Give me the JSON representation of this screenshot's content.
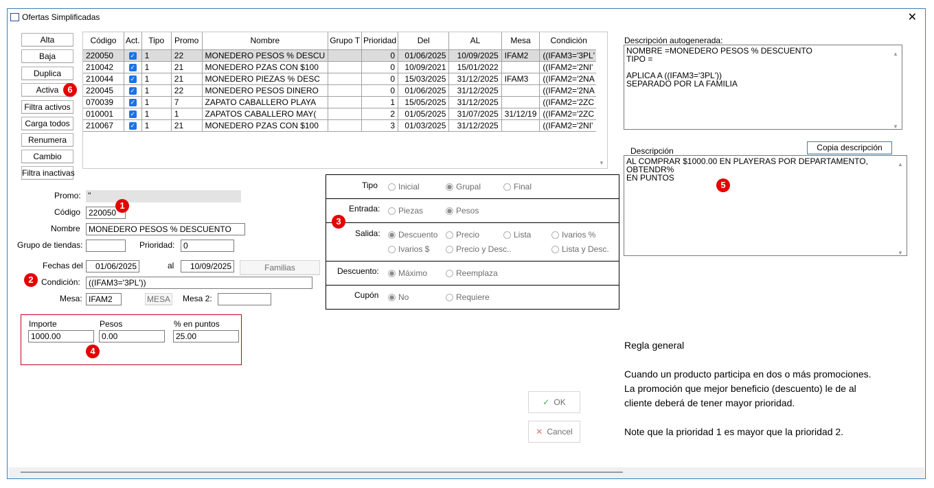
{
  "window": {
    "title": "Ofertas Simplificadas"
  },
  "side_buttons": [
    "Alta",
    "Baja",
    "Duplica",
    "Activa",
    "Filtra activos",
    "Carga todos",
    "Renumera",
    "Cambio",
    "Filtra inactivas"
  ],
  "grid": {
    "columns": [
      "Código",
      "Act.",
      "Tipo",
      "Promo",
      "Nombre",
      "Grupo T",
      "Prioridad",
      "Del",
      "AL",
      "Mesa",
      "Condición"
    ],
    "rows": [
      [
        "220050",
        true,
        "1",
        "22",
        "MONEDERO PESOS % DESCU",
        "",
        "0",
        "01/06/2025",
        "10/09/2025",
        "IFAM2",
        "((IFAM3='3PL'"
      ],
      [
        "210042",
        true,
        "1",
        "21",
        "MONEDERO PZAS CON $100",
        "",
        "0",
        "10/09/2021",
        "15/01/2022",
        "",
        "((IFAM2='2NI'"
      ],
      [
        "210044",
        true,
        "1",
        "21",
        "MONEDERO PIEZAS % DESC",
        "",
        "0",
        "15/03/2025",
        "31/12/2025",
        "IFAM3",
        "((IFAM2='2NA"
      ],
      [
        "220045",
        true,
        "1",
        "22",
        "MONEDERO PESOS DINERO",
        "",
        "0",
        "01/06/2025",
        "31/12/2025",
        "",
        "((IFAM2='2NA"
      ],
      [
        "070039",
        true,
        "1",
        "7",
        "ZAPATO CABALLERO PLAYA",
        "",
        "1",
        "15/05/2025",
        "31/12/2025",
        "",
        "((IFAM2='2ZC"
      ],
      [
        "010001",
        true,
        "1",
        "1",
        "ZAPATOS CABALLERO MAY(",
        "",
        "2",
        "01/05/2025",
        "31/07/2025",
        "31/12/19",
        "((IFAM2='2ZC"
      ],
      [
        "210067",
        true,
        "1",
        "21",
        "MONEDERO PZAS CON $100",
        "",
        "3",
        "01/03/2025",
        "31/12/2025",
        "",
        "((IFAM2='2NI'"
      ]
    ]
  },
  "form": {
    "promo_label": "Promo:",
    "promo_value": "''",
    "codigo_label": "Código",
    "codigo_value": "220050",
    "nombre_label": "Nombre",
    "nombre_value": "MONEDERO PESOS % DESCUENTO",
    "grupo_label": "Grupo de tiendas:",
    "grupo_value": "",
    "prioridad_label": "Prioridad:",
    "prioridad_value": "0",
    "fechas_label": "Fechas del",
    "fecha_del": "01/06/2025",
    "al_label": "al",
    "fecha_al": "10/09/2025",
    "familias_label": "Familias",
    "condicion_label": "Condición:",
    "condicion_value": "((IFAM3='3PL'))",
    "mesa_label": "Mesa:",
    "mesa_value": "IFAM2",
    "mesa_btn": "MESA",
    "mesa2_label": "Mesa 2:",
    "mesa2_value": ""
  },
  "amounts": {
    "importe_label": "Importe",
    "importe_value": "1000.00",
    "pesos_label": "Pesos",
    "pesos_value": "0.00",
    "puntos_label": "% en puntos",
    "puntos_value": "25.00"
  },
  "radios": {
    "tipo": {
      "label": "Tipo",
      "options": [
        "Inicial",
        "Grupal",
        "Final"
      ],
      "selected": 1
    },
    "entrada": {
      "label": "Entrada:",
      "options": [
        "Piezas",
        "Pesos"
      ],
      "selected": 1
    },
    "salida": {
      "label": "Salida:",
      "options": [
        "Descuento",
        "Precio",
        "Lista",
        "Ivarios %",
        "Ivarios $",
        "Precio y Desc..",
        "Lista y Desc."
      ],
      "selected": 0
    },
    "descuento": {
      "label": "Descuento:",
      "options": [
        "Máximo",
        "Reemplaza"
      ],
      "selected": 0
    },
    "cupon": {
      "label": "Cupón",
      "options": [
        "No",
        "Requiere"
      ],
      "selected": 0
    }
  },
  "right": {
    "auto_label": "Descripción autogenerada:",
    "auto_text": "NOMBRE =MONEDERO PESOS % DESCUENTO\nTIPO =\n\nAPLICA A ((IFAM3='3PL'))\nSEPARADO POR LA FAMILIA",
    "desc_label": "Descripción",
    "copy_btn": "Copia descripción",
    "desc_text": "AL COMPRAR $1000.00 EN PLAYERAS POR DEPARTAMENTO, OBTENDR%\nEN PUNTOS"
  },
  "notes": {
    "title": "Regla general",
    "p1": "Cuando un producto participa en dos o más  promociones.",
    "p2": "La promoción que mejor beneficio (descuento)  le de al",
    "p3": "cliente deberá de tener mayor prioridad.",
    "p4": "Note que la prioridad 1 es mayor que la prioridad 2."
  },
  "buttons": {
    "ok": "OK",
    "cancel": "Cancel"
  },
  "badges": [
    "1",
    "2",
    "3",
    "4",
    "5",
    "6"
  ],
  "colors": {
    "badge": "#e60000",
    "check": "#1a73e8",
    "border": "#3c7fb1"
  }
}
